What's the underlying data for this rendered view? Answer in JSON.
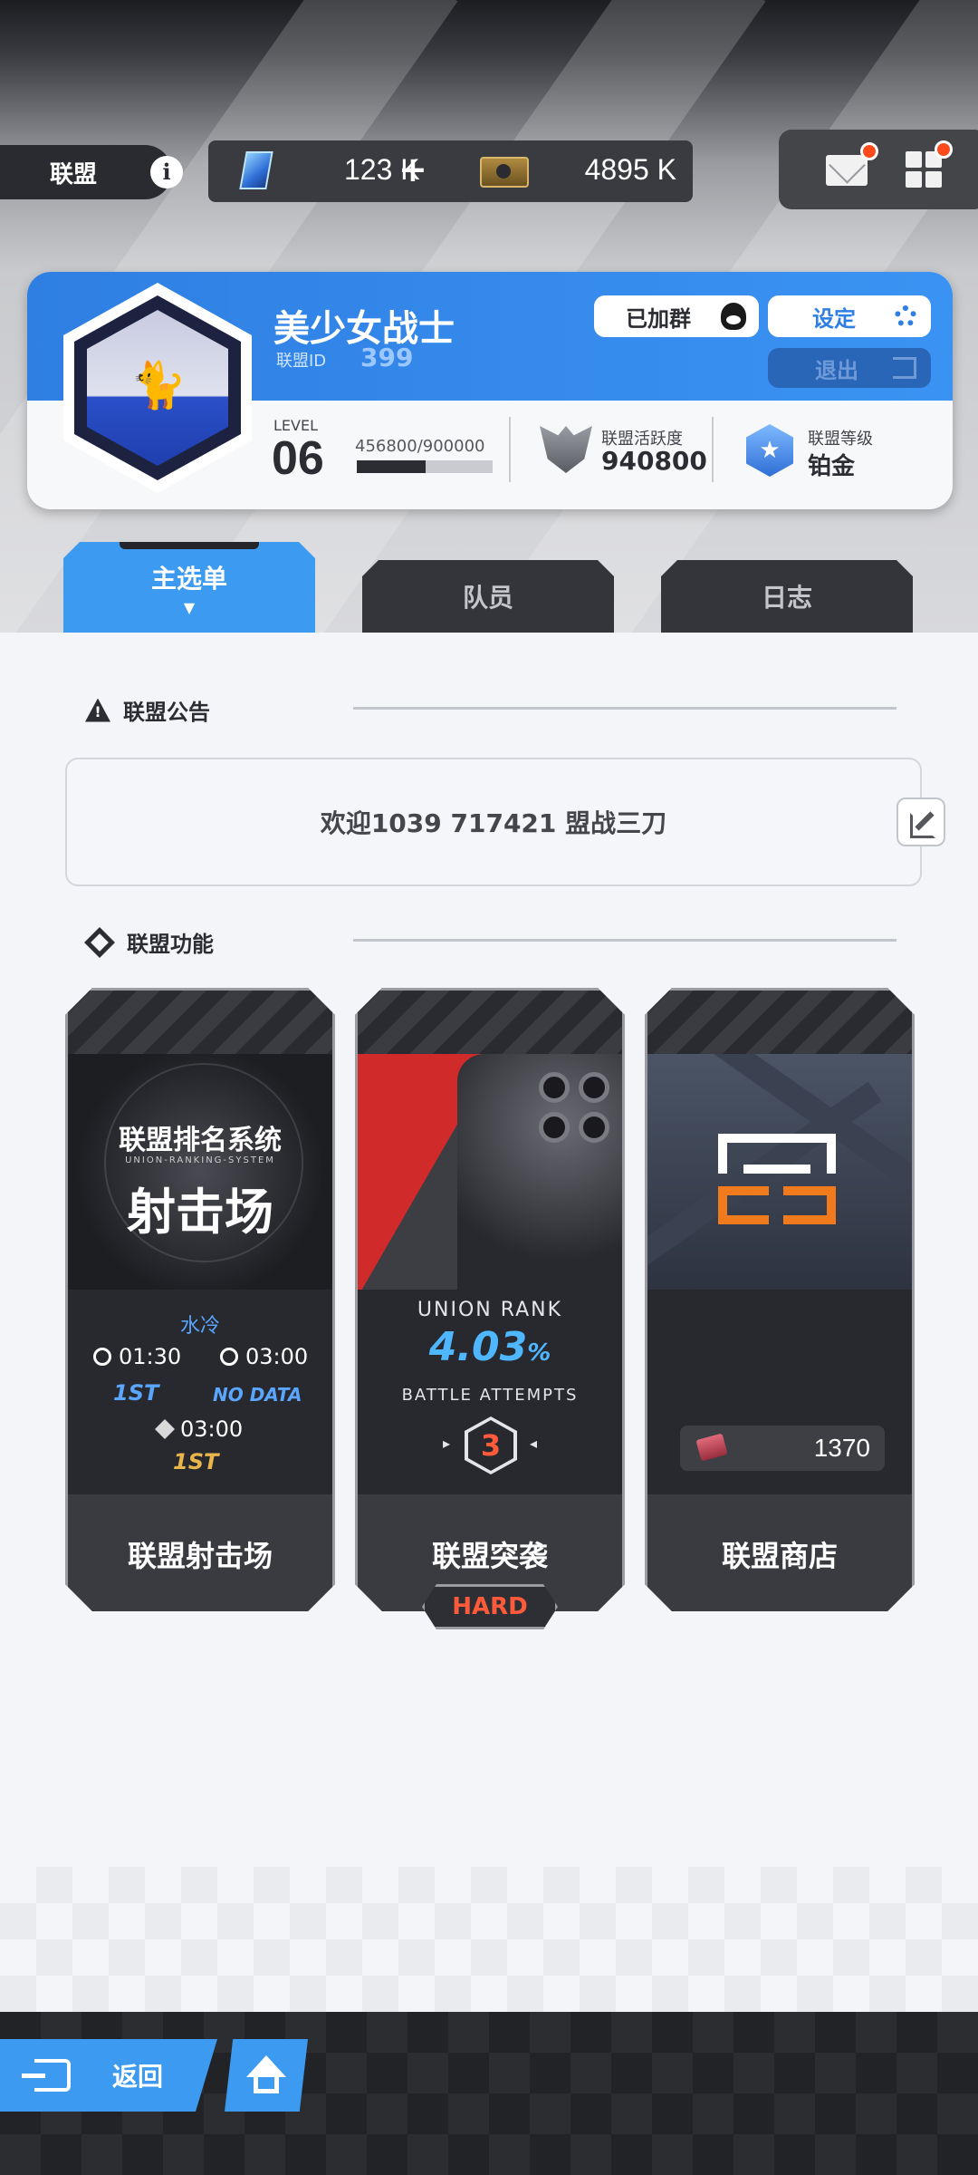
{
  "header": {
    "union_label": "联盟",
    "gem_amount": "123 K",
    "plus": "+",
    "ticket_amount": "4895 K"
  },
  "profile": {
    "union_name": "美少女战士",
    "union_id_label": "联盟ID",
    "union_id": "399",
    "group_button": "已加群",
    "settings_button": "设定",
    "exit_button": "退出",
    "level_label": "LEVEL",
    "level": "06",
    "exp_text": "456800/900000",
    "exp_fraction": 0.507,
    "activity_label": "联盟活跃度",
    "activity_value": "940800",
    "rank_label": "联盟等级",
    "rank_value": "铂金"
  },
  "tabs": [
    {
      "label": "主选单",
      "active": true
    },
    {
      "label": "队员",
      "active": false
    },
    {
      "label": "日志",
      "active": false
    }
  ],
  "notice": {
    "title": "联盟公告",
    "text": "欢迎1039 717421 盟战三刀"
  },
  "functions": {
    "title": "联盟功能",
    "cards": [
      {
        "name": "联盟射击场",
        "art_title": "联盟排名系统",
        "art_subtitle": "UNION-RANKING-SYSTEM",
        "art_big": "射击场",
        "mode": "水冷",
        "time1": "01:30",
        "time2": "03:00",
        "rank1": "1ST",
        "rank2": "NO DATA",
        "time3": "03:00",
        "rank3": "1ST"
      },
      {
        "name": "联盟突袭",
        "union_rank_label": "UNION RANK",
        "union_rank_value": "4.03",
        "union_rank_unit": "%",
        "battle_attempts_label": "BATTLE ATTEMPTS",
        "battle_attempts": "3",
        "difficulty": "HARD"
      },
      {
        "name": "联盟商店",
        "currency": "1370"
      }
    ]
  },
  "bottom": {
    "back_label": "返回"
  },
  "colors": {
    "accent_blue": "#3c9bf0",
    "notification_red": "#ff4a1c",
    "hard_red": "#ff5a3a",
    "rank_cyan": "#4fb7ff",
    "gold": "#e8b64a"
  }
}
